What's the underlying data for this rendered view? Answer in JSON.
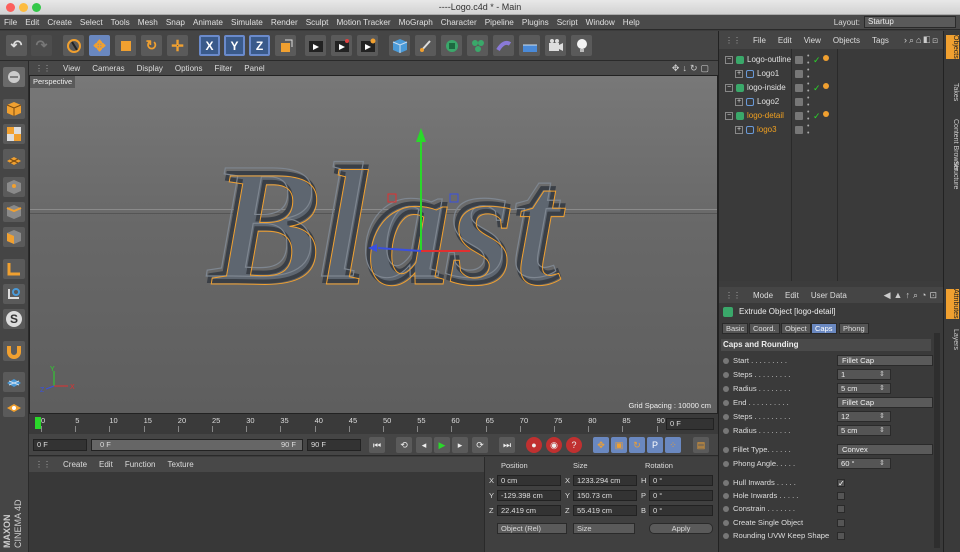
{
  "window": {
    "title": "----Logo.c4d * - Main"
  },
  "menubar": {
    "items": [
      "File",
      "Edit",
      "Create",
      "Select",
      "Tools",
      "Mesh",
      "Snap",
      "Animate",
      "Simulate",
      "Render",
      "Sculpt",
      "Motion Tracker",
      "MoGraph",
      "Character",
      "Pipeline",
      "Plugins",
      "Script",
      "Window",
      "Help"
    ],
    "layout_label": "Layout:",
    "layout_value": "Startup"
  },
  "toolbar": {
    "axis_x": "X",
    "axis_y": "Y",
    "axis_z": "Z"
  },
  "viewport": {
    "menu": [
      "View",
      "Cameras",
      "Display",
      "Options",
      "Filter",
      "Panel"
    ],
    "label": "Perspective",
    "logo_text": "Blast",
    "grid_spacing": "Grid Spacing : 10000 cm",
    "axis_y": "Y",
    "axis_x": "X",
    "axis_z": "Z"
  },
  "timeline": {
    "ticks": [
      "0",
      "5",
      "10",
      "15",
      "20",
      "25",
      "30",
      "35",
      "40",
      "45",
      "50",
      "55",
      "60",
      "65",
      "70",
      "75",
      "80",
      "85",
      "90"
    ],
    "frame_right": "0 F"
  },
  "playbar": {
    "start": "0 F",
    "range_start": "0 F",
    "range_end": "90 F",
    "end": "90 F"
  },
  "material": {
    "menu": [
      "Create",
      "Edit",
      "Function",
      "Texture"
    ]
  },
  "coords": {
    "headers": [
      "Position",
      "Size",
      "Rotation"
    ],
    "rows": [
      {
        "axis": "X",
        "pos": "0 cm",
        "saxis": "X",
        "size": "1233.294 cm",
        "raxis": "H",
        "rot": "0 °"
      },
      {
        "axis": "Y",
        "pos": "-129.398 cm",
        "saxis": "Y",
        "size": "150.73 cm",
        "raxis": "P",
        "rot": "0 °"
      },
      {
        "axis": "Z",
        "pos": "22.419 cm",
        "saxis": "Z",
        "size": "55.419 cm",
        "raxis": "B",
        "rot": "0 °"
      }
    ],
    "mode": "Object (Rel)",
    "size_mode": "Size",
    "apply": "Apply"
  },
  "objects": {
    "menu": [
      "File",
      "Edit",
      "View",
      "Objects",
      "Tags"
    ],
    "items": [
      {
        "name": "Logo-outline",
        "depth": 0,
        "color": "#e0e0e0"
      },
      {
        "name": "Logo1",
        "depth": 1,
        "color": "#e0e0e0"
      },
      {
        "name": "logo-inside",
        "depth": 0,
        "color": "#e0e0e0"
      },
      {
        "name": "Logo2",
        "depth": 1,
        "color": "#e0e0e0"
      },
      {
        "name": "logo-detail",
        "depth": 0,
        "color": "#f0a020"
      },
      {
        "name": "logo3",
        "depth": 1,
        "color": "#f0a020"
      }
    ]
  },
  "attributes": {
    "menu": [
      "Mode",
      "Edit",
      "User Data"
    ],
    "object_title": "Extrude Object [logo-detail]",
    "tabs": [
      "Basic",
      "Coord.",
      "Object",
      "Caps",
      "Phong"
    ],
    "active_tab": "Caps",
    "section": "Caps and Rounding",
    "rows": [
      {
        "label": "Start . . . . . . . . .",
        "type": "button",
        "value": "Fillet Cap"
      },
      {
        "label": "Steps . . . . . . . . .",
        "type": "num",
        "value": "1"
      },
      {
        "label": "Radius . . . . . . . .",
        "type": "num",
        "value": "5 cm"
      },
      {
        "label": "End . . . . . . . . . .",
        "type": "button",
        "value": "Fillet Cap"
      },
      {
        "label": "Steps . . . . . . . . .",
        "type": "num",
        "value": "12"
      },
      {
        "label": "Radius . . . . . . . .",
        "type": "num",
        "value": "5 cm"
      },
      {
        "label": "Fillet Type. . . . . .",
        "type": "button",
        "value": "Convex"
      },
      {
        "label": "Phong Angle. . . . .",
        "type": "num",
        "value": "60 °"
      },
      {
        "label": "Hull Inwards . . . . .",
        "type": "check",
        "value": "✓"
      },
      {
        "label": "Hole Inwards . . . . .",
        "type": "check",
        "value": ""
      },
      {
        "label": "Constrain . . . . . . .",
        "type": "check",
        "value": ""
      },
      {
        "label": "Create Single Object",
        "type": "check",
        "value": ""
      },
      {
        "label": "Rounding UVW Keep Shape",
        "type": "check",
        "value": ""
      }
    ]
  },
  "side_tabs": [
    "Objects",
    "Takes",
    "Content Browser",
    "Structure",
    "Attributes",
    "Layers"
  ],
  "brand": {
    "maxon": "MAXON",
    "cinema": "CINEMA 4D"
  }
}
